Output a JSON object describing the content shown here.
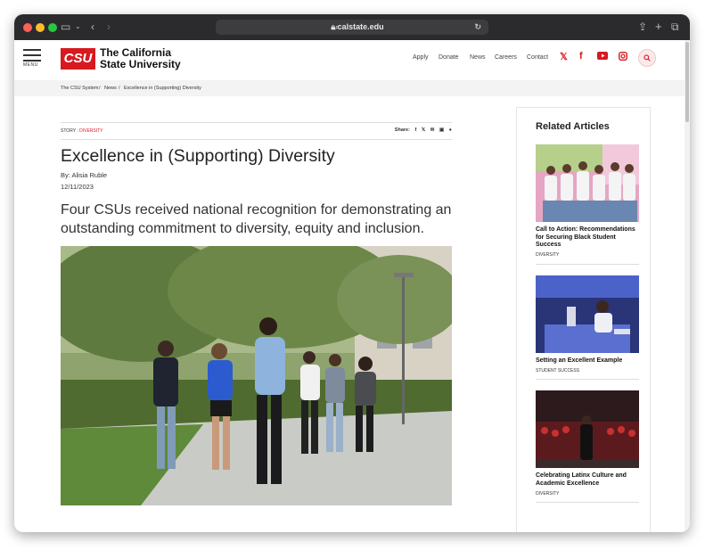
{
  "browser": {
    "url": "calstate.edu"
  },
  "header": {
    "menu_label": "MENU",
    "logo_mark": "CSU",
    "logo_line1": "The California",
    "logo_line2": "State University",
    "nav": [
      "Apply",
      "Donate",
      "News",
      "Careers",
      "Contact"
    ]
  },
  "breadcrumb": {
    "items": [
      "The CSU System",
      "News",
      "Excellence in (Supporting) Diversity"
    ],
    "separator": "/"
  },
  "article": {
    "story_prefix": "STORY : ",
    "story_category": "DIVERSITY",
    "share_label": "Share:",
    "title": "Excellence in (Supporting) Diversity",
    "byline": "By: Alisia Ruble",
    "date": "12/11/2023",
    "lede": "Four CSUs received national recognition for demonstrating an outstanding commitment to diversity, equity and inclusion."
  },
  "sidebar": {
    "title": "Related Articles",
    "articles": [
      {
        "title": "Call to Action: Recommendations for Securing Black Student Success",
        "category": "DIVERSITY"
      },
      {
        "title": "Setting an Excellent Example",
        "category": "STUDENT SUCCESS"
      },
      {
        "title": "Celebrating Latinx Culture and Academic Excellence",
        "category": "DIVERSITY"
      }
    ]
  },
  "colors": {
    "brand_red": "#d71920",
    "text": "#222222"
  }
}
